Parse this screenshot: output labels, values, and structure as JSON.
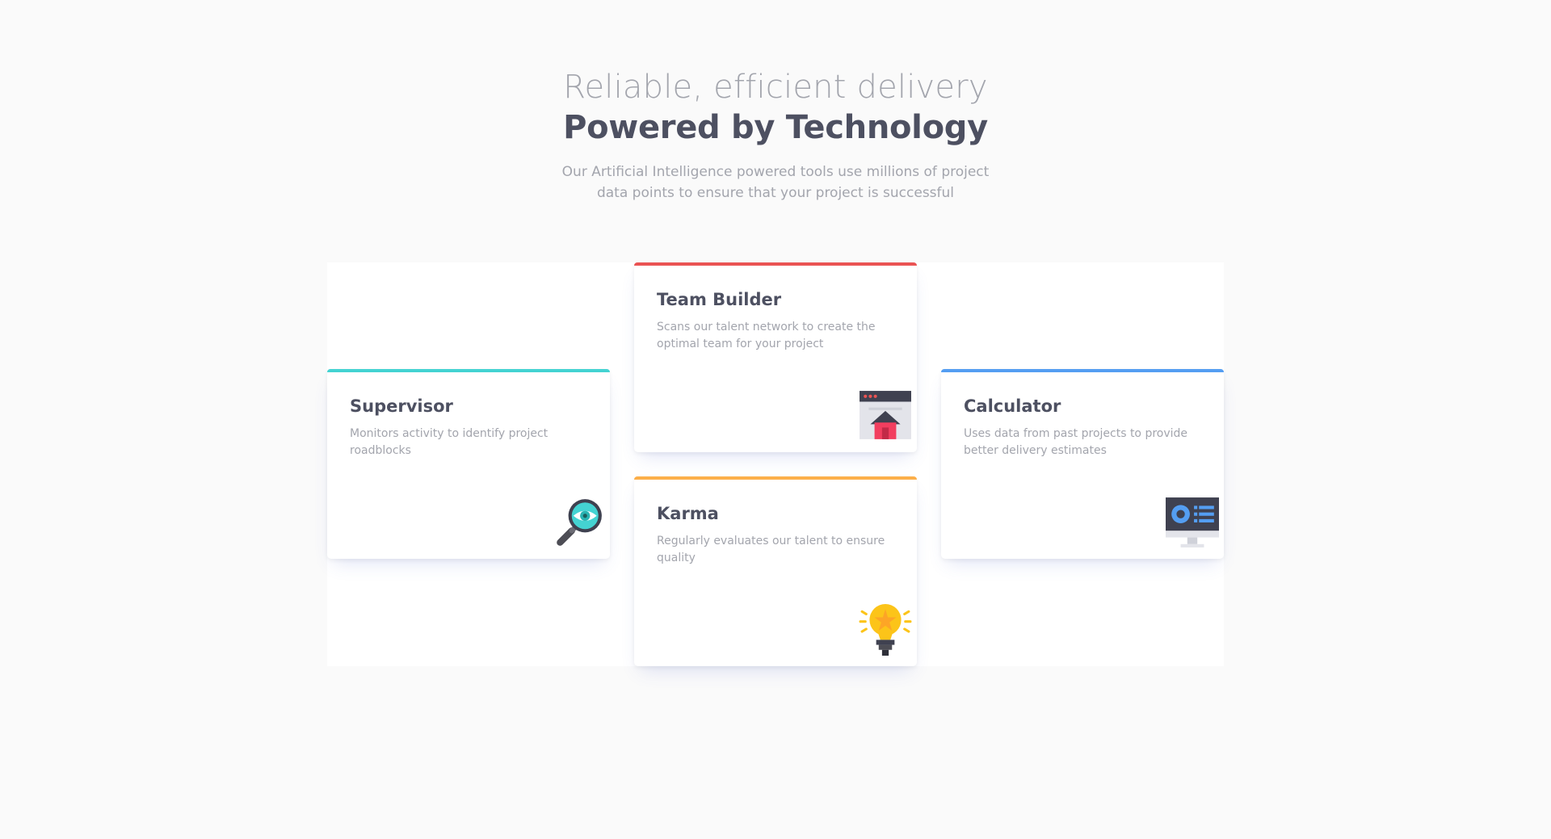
{
  "header": {
    "tagline": "Reliable, efficient delivery",
    "headline": "Powered by Technology",
    "intro": "Our Artificial Intelligence powered tools use millions of project data points to ensure that your project is successful"
  },
  "cards": {
    "supervisor": {
      "title": "Supervisor",
      "description": "Monitors activity to identify project roadblocks",
      "accent": "#44d3d2",
      "icon": "magnifier-eye-icon"
    },
    "team_builder": {
      "title": "Team Builder",
      "description": "Scans our talent network to create the optimal team for your project",
      "accent": "#ea5353",
      "icon": "browser-home-icon"
    },
    "karma": {
      "title": "Karma",
      "description": "Regularly evaluates our talent to ensure quality",
      "accent": "#fcaf4a",
      "icon": "lightbulb-icon"
    },
    "calculator": {
      "title": "Calculator",
      "description": "Uses data from past projects to provide better delivery estimates",
      "accent": "#549ef2",
      "icon": "monitor-dashboard-icon"
    }
  }
}
